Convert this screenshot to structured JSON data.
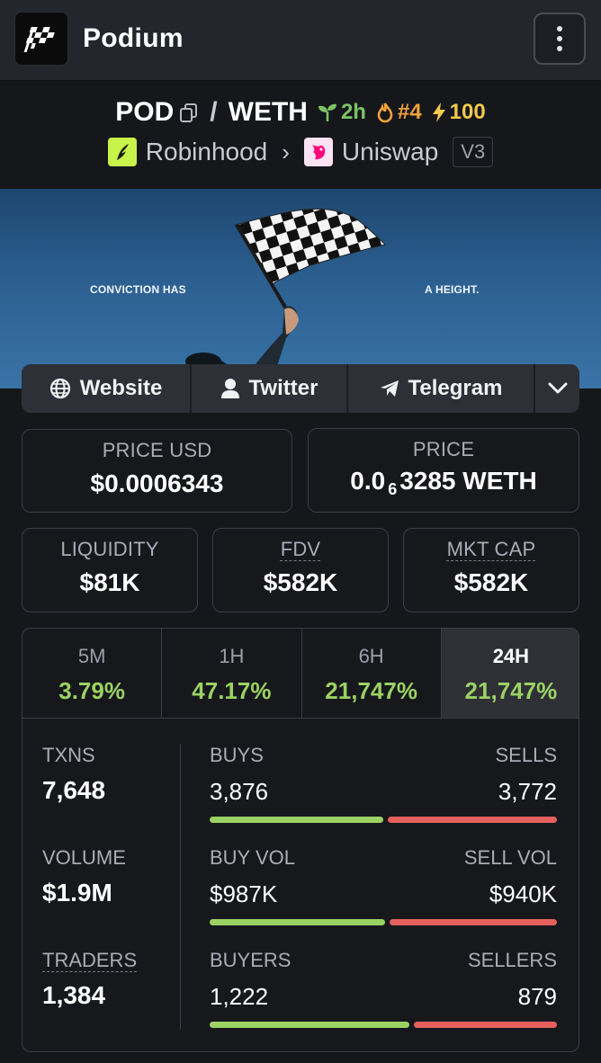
{
  "header": {
    "app_name": "Podium",
    "logo_icon": "checkered-flag-icon",
    "menu_icon": "more-vertical-icon"
  },
  "pair": {
    "base": "POD",
    "separator": "/",
    "quote": "WETH",
    "age": "2h",
    "rank": "#4",
    "boosts": "100",
    "chain": "Robinhood",
    "dex": "Uniswap",
    "dex_version": "V3"
  },
  "banner": {
    "left_text": "CONVICTION HAS",
    "right_text": "A HEIGHT."
  },
  "links": [
    {
      "label": "Website",
      "icon": "globe-icon"
    },
    {
      "label": "Twitter",
      "icon": "user-icon"
    },
    {
      "label": "Telegram",
      "icon": "send-icon"
    }
  ],
  "price": {
    "usd_label": "PRICE USD",
    "usd_value": "$0.0006343",
    "native_label": "PRICE",
    "native_prefix": "0.0",
    "native_zeros": "6",
    "native_digits": "3285",
    "native_unit": "WETH"
  },
  "metrics": {
    "liquidity_label": "LIQUIDITY",
    "liquidity_value": "$81K",
    "fdv_label": "FDV",
    "fdv_value": "$582K",
    "mcap_label": "MKT CAP",
    "mcap_value": "$582K"
  },
  "periods": [
    {
      "label": "5M",
      "change": "3.79%"
    },
    {
      "label": "1H",
      "change": "47.17%"
    },
    {
      "label": "6H",
      "change": "21,747%"
    },
    {
      "label": "24H",
      "change": "21,747%"
    }
  ],
  "active_period": "24H",
  "stats": {
    "txns_label": "TXNS",
    "txns_value": "7,648",
    "volume_label": "VOLUME",
    "volume_value": "$1.9M",
    "traders_label": "TRADERS",
    "traders_value": "1,384",
    "buys_label": "BUYS",
    "buys_value": "3,876",
    "sells_label": "SELLS",
    "sells_value": "3,772",
    "buy_vol_label": "BUY VOL",
    "buy_vol_value": "$987K",
    "sell_vol_label": "SELL VOL",
    "sell_vol_value": "$940K",
    "buyers_label": "BUYERS",
    "buyers_value": "1,222",
    "sellers_label": "SELLERS",
    "sellers_value": "879"
  },
  "ratios": {
    "buys": 0.507,
    "buy_vol": 0.512,
    "buyers": 0.582
  },
  "colors": {
    "positive": "#9bd263",
    "negative": "#e5605c",
    "age": "#7ac466",
    "rank": "#f0a23a",
    "boost": "#f2c94c"
  }
}
